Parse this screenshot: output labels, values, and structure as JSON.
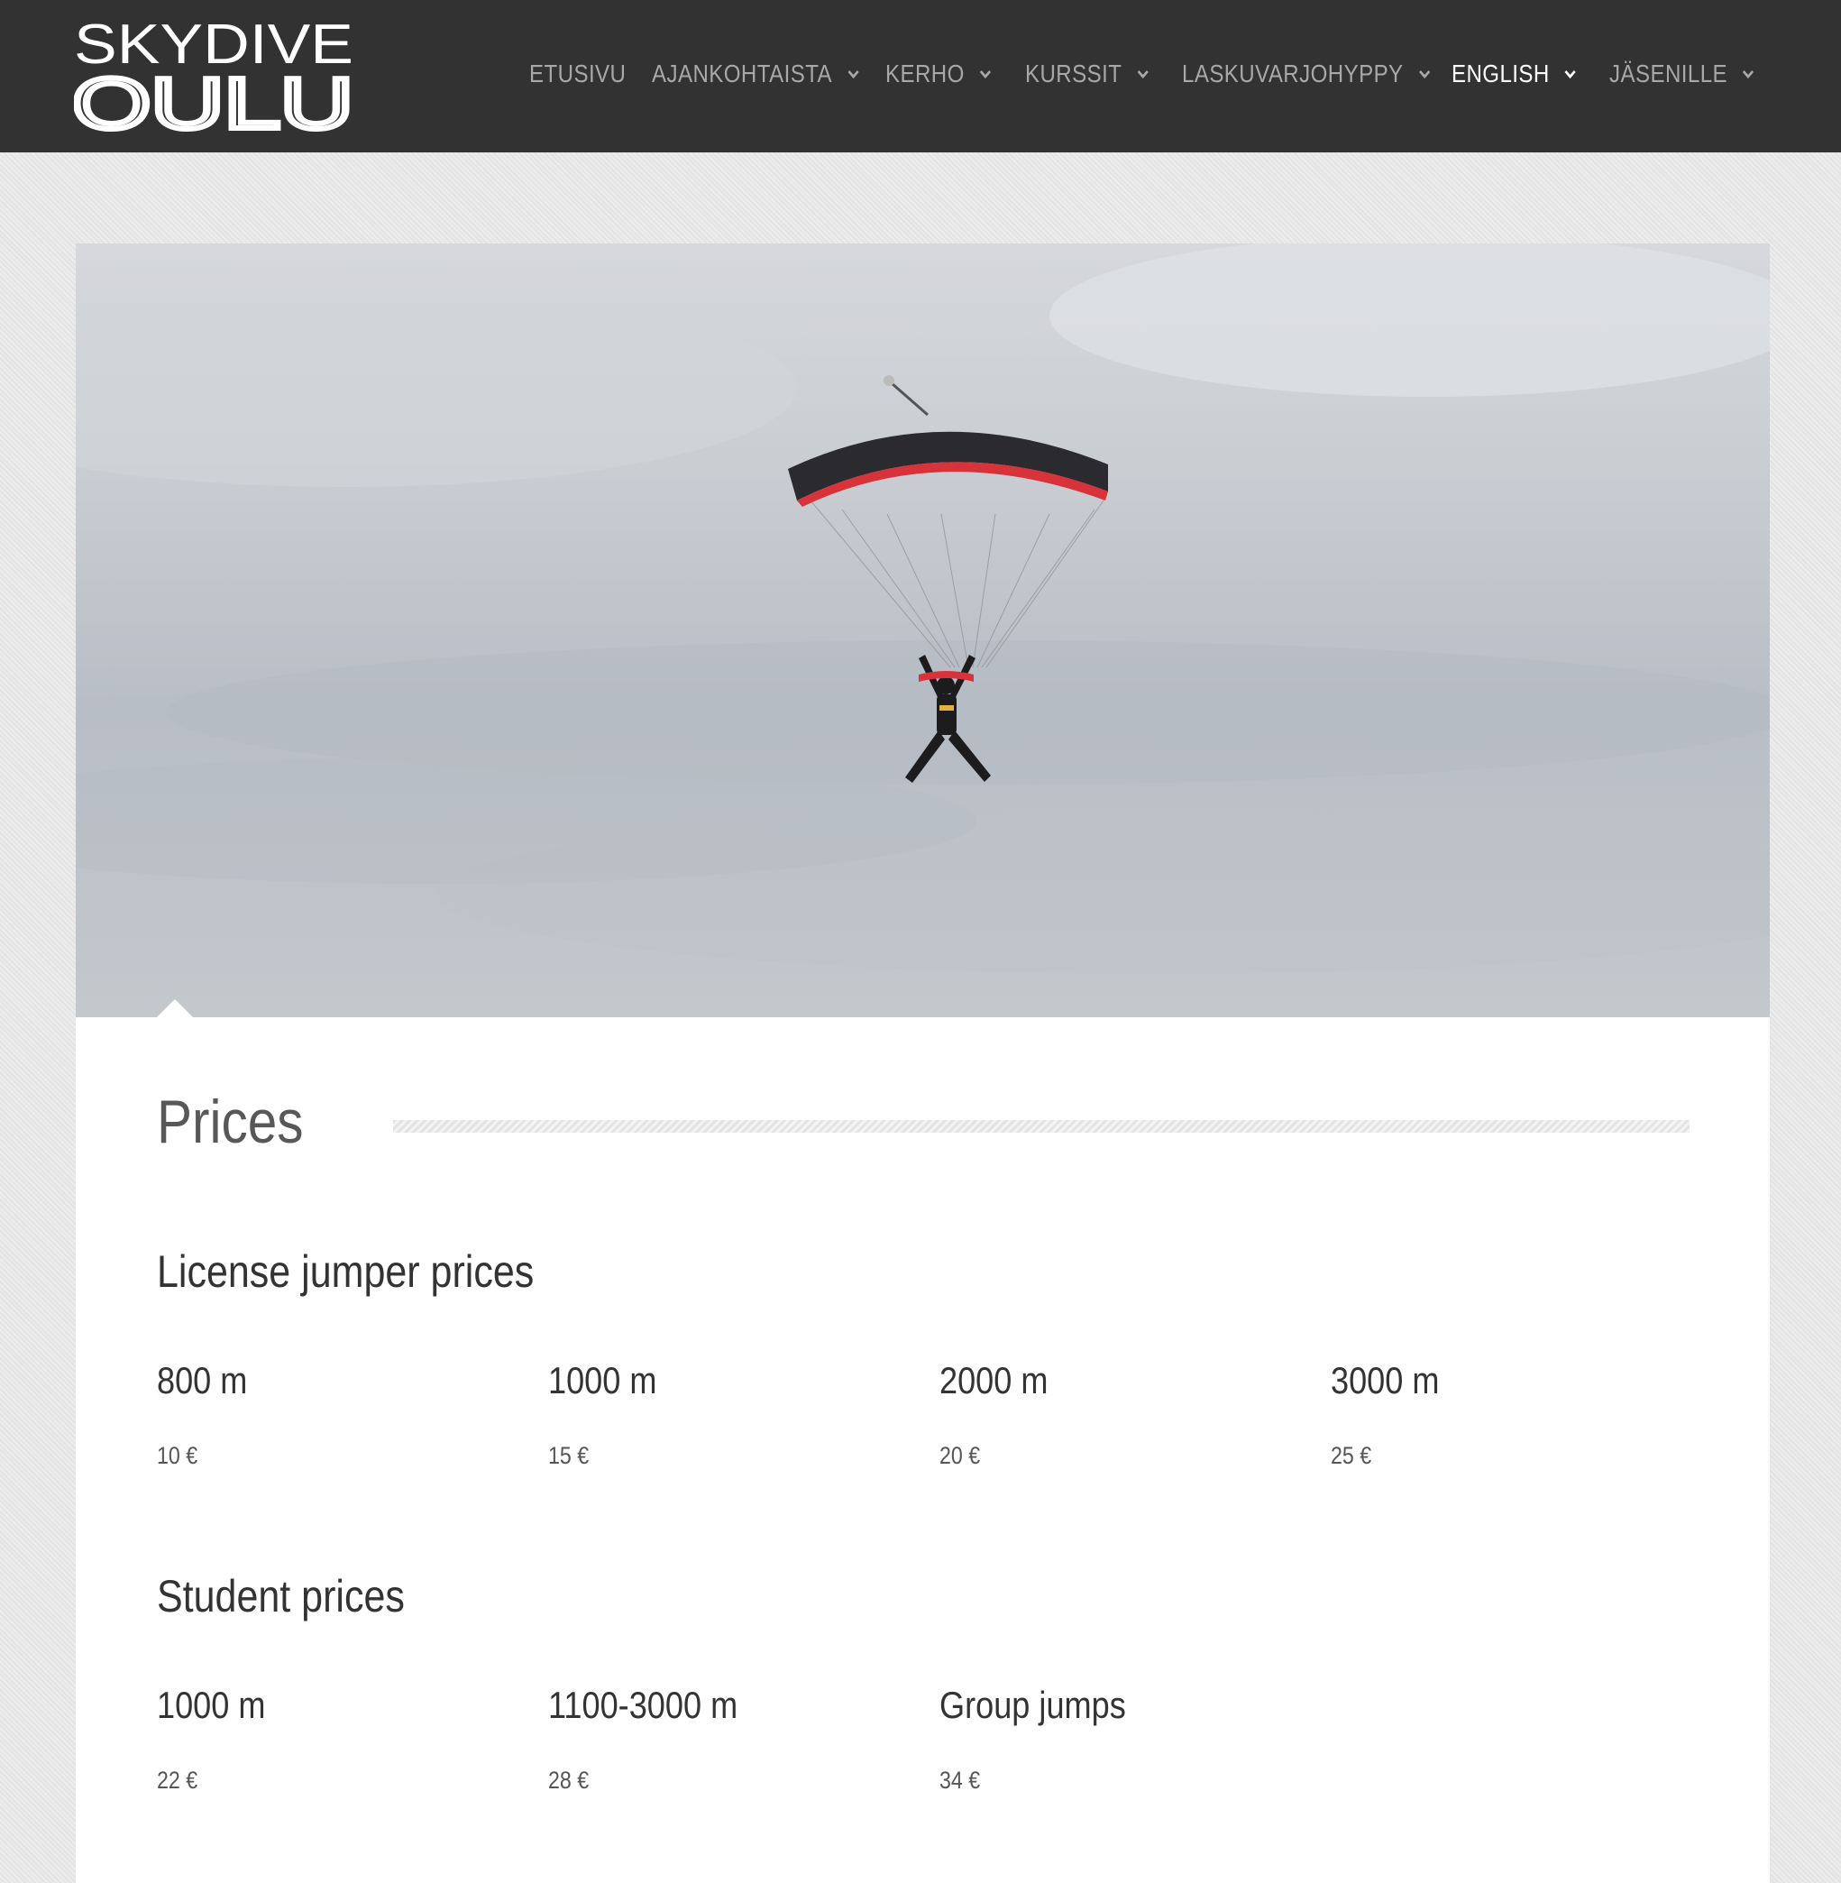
{
  "header": {
    "logo_line1": "SKYDIVE",
    "logo_line2": "OULU",
    "nav": [
      {
        "label": "ETUSIVU",
        "dropdown": false,
        "active": false
      },
      {
        "label": "AJANKOHTAISTA",
        "dropdown": true,
        "active": false
      },
      {
        "label": "KERHO",
        "dropdown": true,
        "active": false
      },
      {
        "label": "KURSSIT",
        "dropdown": true,
        "active": false
      },
      {
        "label": "LASKUVARJOHYPPY",
        "dropdown": true,
        "active": false
      },
      {
        "label": "ENGLISH",
        "dropdown": true,
        "active": true
      },
      {
        "label": "JÄSENILLE",
        "dropdown": true,
        "active": false
      }
    ]
  },
  "page": {
    "title": "Prices",
    "sections": [
      {
        "heading": "License jumper prices",
        "items": [
          {
            "altitude": "800 m",
            "price": "10 €"
          },
          {
            "altitude": "1000 m",
            "price": "15 €"
          },
          {
            "altitude": "2000 m",
            "price": "20 €"
          },
          {
            "altitude": "3000 m",
            "price": "25 €"
          }
        ]
      },
      {
        "heading": "Student prices",
        "items": [
          {
            "altitude": "1000 m",
            "price": "22 €"
          },
          {
            "altitude": "1100-3000 m",
            "price": "28 €"
          },
          {
            "altitude": "Group jumps",
            "price": "34 €"
          }
        ]
      }
    ]
  },
  "colors": {
    "header_bg": "#323232",
    "nav_text": "#a8a8a8",
    "nav_active": "#ffffff",
    "page_bg": "#e7e7e7",
    "card_bg": "#ffffff"
  }
}
